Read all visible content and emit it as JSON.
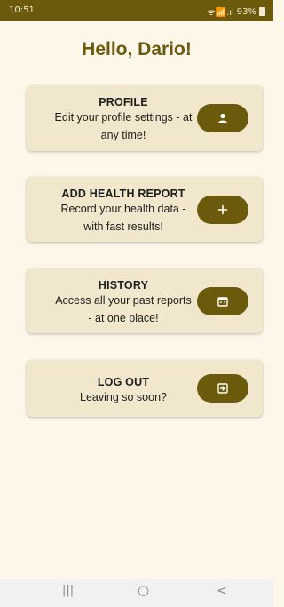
{
  "status_bar": {
    "time": "10:51",
    "signal_text": "ᯤ📶.ıl",
    "battery": "93%"
  },
  "greeting": "Hello, Dario!",
  "cards": [
    {
      "title": "PROFILE",
      "desc_line1": "Edit your profile settings - at",
      "desc_line2": "any time!",
      "icon": "person-icon"
    },
    {
      "title": "ADD HEALTH REPORT",
      "desc_line1": "Record your health data -",
      "desc_line2": "with fast results!",
      "icon": "plus-icon"
    },
    {
      "title": "HISTORY",
      "desc_line1": "Access all your past reports",
      "desc_line2": "- at one place!",
      "icon": "calendar-icon"
    },
    {
      "title": "LOG OUT",
      "desc_line1": "Leaving so soon?",
      "desc_line2": "",
      "icon": "logout-icon"
    }
  ],
  "nav": {
    "recents": "|||",
    "home": "○",
    "back": "<"
  },
  "colors": {
    "accent": "#6b5a0c",
    "card_bg": "#f1e7cd",
    "page_bg": "#fdf7ea"
  }
}
